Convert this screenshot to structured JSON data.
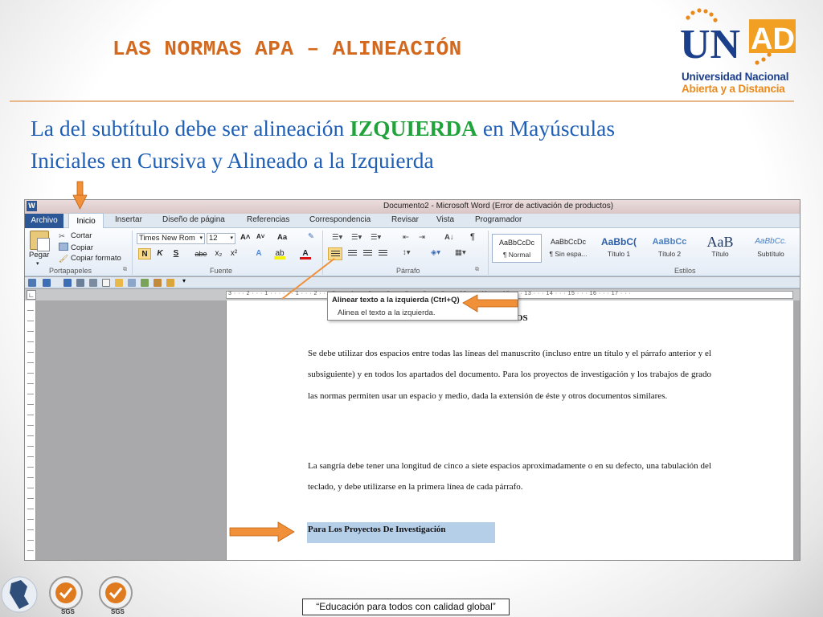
{
  "slide": {
    "title": "LAS NORMAS APA – ALINEACIÓN",
    "intro_line1_before": "La del subtítulo debe ser alineación ",
    "intro_emphasis": "IZQUIERDA",
    "intro_line1_after": " en Mayúsculas",
    "intro_line2": "Iniciales en Cursiva y Alineado a la Izquierda",
    "footer_quote": "“Educación para todos con calidad global”"
  },
  "logo": {
    "letters_un": "UN",
    "letters_ad": "AD",
    "line1": "Universidad Nacional",
    "line2": "Abierta y a Distancia"
  },
  "badges": {
    "sgs_label": "SGS"
  },
  "word": {
    "app_icon": "W",
    "window_title": "Documento2 - Microsoft Word (Error de activación de productos)",
    "file_tab": "Archivo",
    "active_tab": "Inicio",
    "tabs": [
      "Insertar",
      "Diseño de página",
      "Referencias",
      "Correspondencia",
      "Revisar",
      "Vista",
      "Programador"
    ],
    "clipboard": {
      "paste": "Pegar",
      "cut": "Cortar",
      "copy": "Copiar",
      "format_painter": "Copiar formato",
      "group": "Portapapeles"
    },
    "font": {
      "family": "Times New Rom",
      "size": "12",
      "group": "Fuente",
      "bold": "N",
      "italic": "K",
      "underline": "S",
      "strike": "abe",
      "subscript": "x₂",
      "superscript": "x²",
      "grow": "A˄",
      "shrink": "A˅",
      "case": "Aa"
    },
    "paragraph": {
      "group": "Párrafo",
      "pilcrow": "¶",
      "sort": "A↓"
    },
    "styles": {
      "group": "Estilos",
      "items": [
        {
          "preview": "AaBbCcDc",
          "name": "¶ Normal"
        },
        {
          "preview": "AaBbCcDc",
          "name": "¶ Sin espa..."
        },
        {
          "preview": "AaBbC(",
          "name": "Título 1"
        },
        {
          "preview": "AaBbCc",
          "name": "Título 2"
        },
        {
          "preview": "AaB",
          "name": "Título"
        },
        {
          "preview": "AaBbCc.",
          "name": "Subtítulo"
        }
      ]
    },
    "ruler_numbers": "3 · · · 2 · · · 1 · · · · · · 1 · · · 2 · · · 3 · · · 4 · · · 5 · · · 6 · · · 7 · · · 8 · · · 9 · · · 10 · · · 11 · · · 12 · · · 13 · · · 14 · · · 15 · · · 16 · · · 17 · · ·",
    "tooltip": {
      "title": "Alinear texto a la izquierda (Ctrl+Q)",
      "description": "Alinea el texto a la izquierda."
    },
    "document": {
      "heading": "TRABAJOS",
      "paragraph1": "Se debe utilizar dos espacios entre todas las líneas del manuscrito (incluso entre un título y el párrafo anterior y el subsiguiente) y en todos los apartados del documento. Para los proyectos de investigación y los trabajos de grado las normas permiten usar un espacio y medio, dada la extensión de éste y otros documentos similares.",
      "paragraph2": "La sangría debe tener una longitud de cinco a siete espacios aproximadamente o en su defecto, una tabulación del teclado, y debe utilizarse en la primera línea de cada párrafo.",
      "subheading": "Para Los Proyectos De Investigación"
    }
  },
  "colors": {
    "title": "#d2691e",
    "intro": "#1f5fb5",
    "emphasis": "#20a33a",
    "arrow": "#f0913a",
    "logo_blue": "#1c3f8c",
    "logo_orange": "#e98a1a",
    "word_blue": "#2b5797",
    "selection": "#b6cfe9"
  }
}
